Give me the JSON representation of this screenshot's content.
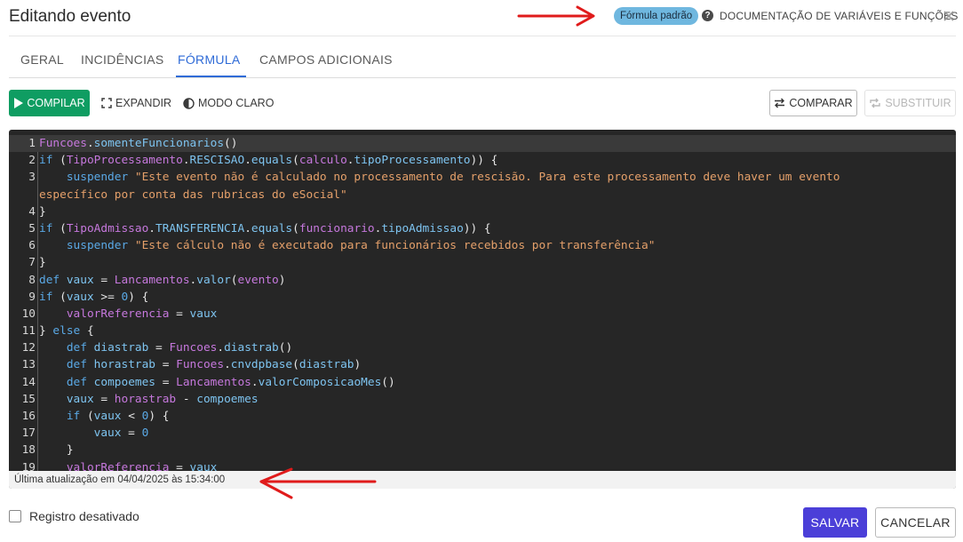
{
  "header": {
    "title": "Editando evento",
    "badge": "Fórmula padrão",
    "help_icon": "question-circle-icon",
    "doc_link": "DOCUMENTAÇÃO DE VARIÁVEIS E FUNÇÕES",
    "close_icon": "close-icon"
  },
  "tabs": [
    {
      "label": "GERAL",
      "active": false
    },
    {
      "label": "INCIDÊNCIAS",
      "active": false
    },
    {
      "label": "FÓRMULA",
      "active": true
    },
    {
      "label": "CAMPOS ADICIONAIS",
      "active": false
    }
  ],
  "toolbar": {
    "compile": "COMPILAR",
    "expand": "EXPANDIR",
    "light_mode": "MODO CLARO",
    "compare": "COMPARAR",
    "replace": "SUBSTITUIR"
  },
  "editor": {
    "status": "Última atualização em 04/04/2025 às 15:34:00",
    "lines": [
      {
        "n": "1",
        "tokens": [
          [
            "cls",
            "Funcoes"
          ],
          [
            "op",
            "."
          ],
          [
            "mem",
            "somenteFuncionarios"
          ],
          [
            "op",
            "()"
          ]
        ]
      },
      {
        "n": "2",
        "tokens": [
          [
            "kw",
            "if"
          ],
          [
            "op",
            " ("
          ],
          [
            "cls",
            "TipoProcessamento"
          ],
          [
            "op",
            "."
          ],
          [
            "mem",
            "RESCISAO"
          ],
          [
            "op",
            "."
          ],
          [
            "mem",
            "equals"
          ],
          [
            "op",
            "("
          ],
          [
            "cls",
            "calculo"
          ],
          [
            "op",
            "."
          ],
          [
            "mem",
            "tipoProcessamento"
          ],
          [
            "op",
            "))"
          ],
          [
            "op",
            " {"
          ]
        ]
      },
      {
        "n": "3",
        "tokens": [
          [
            "op",
            "    "
          ],
          [
            "kw",
            "suspender"
          ],
          [
            "op",
            " "
          ],
          [
            "str",
            "\"Este evento não é calculado no processamento de rescisão. Para este processamento deve haver um evento"
          ]
        ]
      },
      {
        "n": "",
        "tokens": [
          [
            "str",
            "específico por conta das rubricas do eSocial\""
          ]
        ]
      },
      {
        "n": "4",
        "tokens": [
          [
            "op",
            "}"
          ]
        ]
      },
      {
        "n": "5",
        "tokens": [
          [
            "kw",
            "if"
          ],
          [
            "op",
            " ("
          ],
          [
            "cls",
            "TipoAdmissao"
          ],
          [
            "op",
            "."
          ],
          [
            "mem",
            "TRANSFERENCIA"
          ],
          [
            "op",
            "."
          ],
          [
            "mem",
            "equals"
          ],
          [
            "op",
            "("
          ],
          [
            "cls",
            "funcionario"
          ],
          [
            "op",
            "."
          ],
          [
            "mem",
            "tipoAdmissao"
          ],
          [
            "op",
            "))"
          ],
          [
            "op",
            " {"
          ]
        ]
      },
      {
        "n": "6",
        "tokens": [
          [
            "op",
            "    "
          ],
          [
            "kw",
            "suspender"
          ],
          [
            "op",
            " "
          ],
          [
            "str",
            "\"Este cálculo não é executado para funcionários recebidos por transferência\""
          ]
        ]
      },
      {
        "n": "7",
        "tokens": [
          [
            "op",
            "}"
          ]
        ]
      },
      {
        "n": "8",
        "tokens": [
          [
            "kw",
            "def"
          ],
          [
            "op",
            " "
          ],
          [
            "mem",
            "vaux"
          ],
          [
            "op",
            " = "
          ],
          [
            "cls",
            "Lancamentos"
          ],
          [
            "op",
            "."
          ],
          [
            "mem",
            "valor"
          ],
          [
            "op",
            "("
          ],
          [
            "cls",
            "evento"
          ],
          [
            "op",
            ")"
          ]
        ]
      },
      {
        "n": "9",
        "tokens": [
          [
            "kw",
            "if"
          ],
          [
            "op",
            " ("
          ],
          [
            "mem",
            "vaux"
          ],
          [
            "op",
            " >= "
          ],
          [
            "num",
            "0"
          ],
          [
            "op",
            ") {"
          ]
        ]
      },
      {
        "n": "10",
        "tokens": [
          [
            "op",
            "    "
          ],
          [
            "cls",
            "valorReferencia"
          ],
          [
            "op",
            " = "
          ],
          [
            "mem",
            "vaux"
          ]
        ]
      },
      {
        "n": "11",
        "tokens": [
          [
            "op",
            "} "
          ],
          [
            "kw",
            "else"
          ],
          [
            "op",
            " {"
          ]
        ]
      },
      {
        "n": "12",
        "tokens": [
          [
            "op",
            "    "
          ],
          [
            "kw",
            "def"
          ],
          [
            "op",
            " "
          ],
          [
            "mem",
            "diastrab"
          ],
          [
            "op",
            " = "
          ],
          [
            "cls",
            "Funcoes"
          ],
          [
            "op",
            "."
          ],
          [
            "mem",
            "diastrab"
          ],
          [
            "op",
            "()"
          ]
        ]
      },
      {
        "n": "13",
        "tokens": [
          [
            "op",
            "    "
          ],
          [
            "kw",
            "def"
          ],
          [
            "op",
            " "
          ],
          [
            "mem",
            "horastrab"
          ],
          [
            "op",
            " = "
          ],
          [
            "cls",
            "Funcoes"
          ],
          [
            "op",
            "."
          ],
          [
            "mem",
            "cnvdpbase"
          ],
          [
            "op",
            "("
          ],
          [
            "mem",
            "diastrab"
          ],
          [
            "op",
            ")"
          ]
        ]
      },
      {
        "n": "14",
        "tokens": [
          [
            "op",
            "    "
          ],
          [
            "kw",
            "def"
          ],
          [
            "op",
            " "
          ],
          [
            "mem",
            "compoemes"
          ],
          [
            "op",
            " = "
          ],
          [
            "cls",
            "Lancamentos"
          ],
          [
            "op",
            "."
          ],
          [
            "mem",
            "valorComposicaoMes"
          ],
          [
            "op",
            "()"
          ]
        ]
      },
      {
        "n": "15",
        "tokens": [
          [
            "op",
            "    "
          ],
          [
            "mem",
            "vaux"
          ],
          [
            "op",
            " = "
          ],
          [
            "cls",
            "horastrab"
          ],
          [
            "op",
            " - "
          ],
          [
            "mem",
            "compoemes"
          ]
        ]
      },
      {
        "n": "16",
        "tokens": [
          [
            "op",
            "    "
          ],
          [
            "kw",
            "if"
          ],
          [
            "op",
            " ("
          ],
          [
            "mem",
            "vaux"
          ],
          [
            "op",
            " < "
          ],
          [
            "num",
            "0"
          ],
          [
            "op",
            ") {"
          ]
        ]
      },
      {
        "n": "17",
        "tokens": [
          [
            "op",
            "        "
          ],
          [
            "mem",
            "vaux"
          ],
          [
            "op",
            " = "
          ],
          [
            "num",
            "0"
          ]
        ]
      },
      {
        "n": "18",
        "tokens": [
          [
            "op",
            "    }"
          ]
        ]
      },
      {
        "n": "19",
        "tokens": [
          [
            "op",
            "    "
          ],
          [
            "cls",
            "valorReferencia"
          ],
          [
            "op",
            " = "
          ],
          [
            "mem",
            "vaux"
          ]
        ]
      }
    ]
  },
  "footer": {
    "checkbox_label": "Registro desativado",
    "checked": false,
    "save": "SALVAR",
    "cancel": "CANCELAR"
  },
  "colors": {
    "primary": "#4b3fd8",
    "compile_green": "#0f9d62",
    "tab_active": "#2f6bd7",
    "badge": "#6fb7df",
    "annotation_arrow": "#e01b1b"
  }
}
